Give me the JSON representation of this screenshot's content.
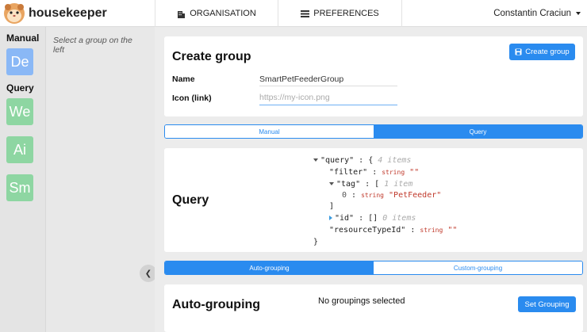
{
  "nav": {
    "brand": "housekeeper",
    "organisation": "ORGANISATION",
    "preferences": "PREFERENCES",
    "user": "Constantin Craciun"
  },
  "sidebar": {
    "manual_label": "Manual",
    "query_label": "Query",
    "manual_groups": [
      {
        "abbr": "De"
      }
    ],
    "query_groups": [
      {
        "abbr": "We"
      },
      {
        "abbr": "Ai"
      },
      {
        "abbr": "Sm"
      }
    ],
    "hint": "Select a group on the left",
    "colors": {
      "manual": "#8ab8f6",
      "query": "#8ed6a2"
    }
  },
  "create": {
    "title": "Create group",
    "button": "Create group",
    "name_label": "Name",
    "name_value": "SmartPetFeederGroup",
    "icon_label": "Icon (link)",
    "icon_placeholder": "https://my-icon.png"
  },
  "mode_tabs": {
    "manual": "Manual",
    "query": "Query",
    "selected": "Query"
  },
  "query": {
    "title": "Query",
    "json": {
      "root_key": "\"query\"",
      "root_count": "4 items",
      "filter_key": "\"filter\"",
      "filter_type": "string",
      "filter_value": "\"\"",
      "tag_key": "\"tag\"",
      "tag_count": "1 item",
      "tag_index": "0",
      "tag_type": "string",
      "tag_value": "\"PetFeeder\"",
      "id_key": "\"id\"",
      "id_count": "0 items",
      "rt_key": "\"resourceTypeId\"",
      "rt_type": "string",
      "rt_value": "\"\""
    }
  },
  "grouping_tabs": {
    "auto": "Auto-grouping",
    "custom": "Custom-grouping",
    "selected": "Auto-grouping"
  },
  "auto": {
    "title": "Auto-grouping",
    "status": "No groupings selected",
    "button": "Set Grouping"
  },
  "colors": {
    "accent": "#2a8bef"
  }
}
